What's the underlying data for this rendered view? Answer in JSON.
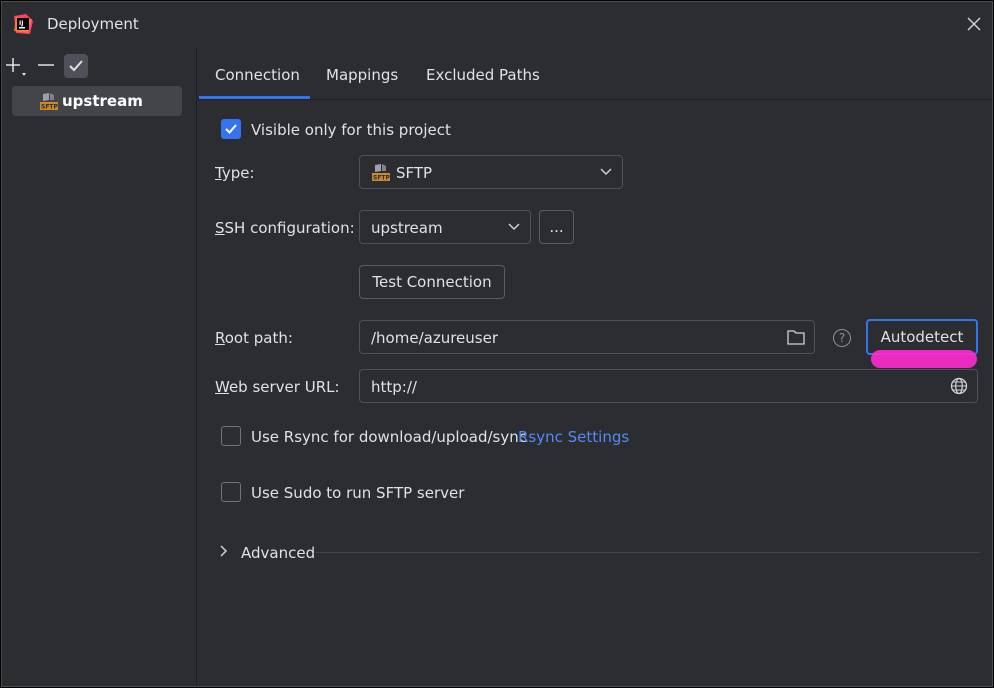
{
  "window": {
    "title": "Deployment"
  },
  "sidebar": {
    "items": [
      {
        "label": "upstream",
        "icon": "sftp-icon"
      }
    ]
  },
  "tabs": [
    {
      "label": "Connection"
    },
    {
      "label": "Mappings"
    },
    {
      "label": "Excluded Paths"
    }
  ],
  "connection": {
    "visible_only": {
      "label": "Visible only for this project",
      "checked": true
    },
    "type": {
      "label_mnemonic": "T",
      "label_rest": "ype:",
      "value": "SFTP"
    },
    "ssh": {
      "label_mnemonic": "S",
      "label_rest": "SH configuration:",
      "value": "upstream",
      "more_label": "..."
    },
    "test_connection_label": "Test Connection",
    "root_path": {
      "label_mnemonic": "R",
      "label_rest": "oot path:",
      "value": "/home/azureuser",
      "help": "?",
      "autodetect_label": "Autodetect"
    },
    "web_server": {
      "label_mnemonic": "W",
      "label_rest": "eb server URL:",
      "value": "http://"
    },
    "rsync": {
      "label": "Use Rsync for download/upload/sync",
      "link": "Rsync Settings",
      "checked": false
    },
    "sudo": {
      "label": "Use Sudo to run SFTP server",
      "checked": false
    },
    "advanced_label": "Advanced"
  },
  "colors": {
    "accent": "#3574f0",
    "link": "#548af7",
    "highlight": "#ff2bd0",
    "background": "#2b2d30"
  }
}
